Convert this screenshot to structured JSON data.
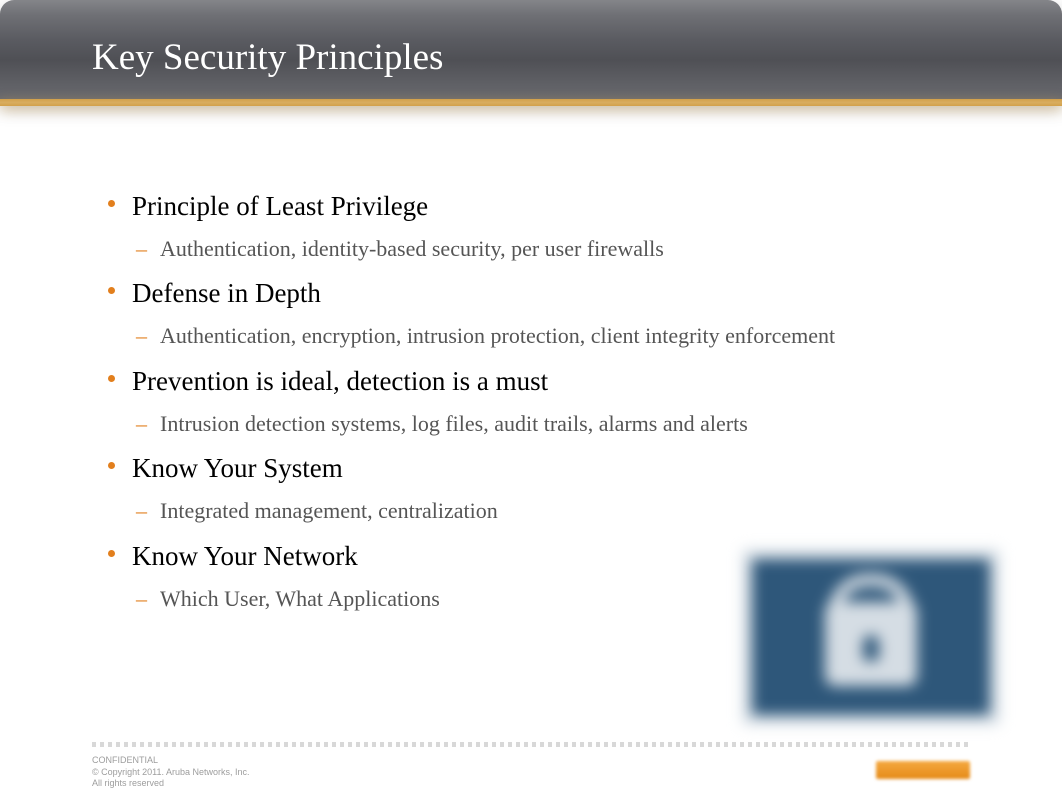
{
  "slide": {
    "title": "Key Security Principles",
    "items": [
      {
        "title": "Principle of Least Privilege",
        "sub": "Authentication, identity-based security, per user firewalls"
      },
      {
        "title": "Defense in Depth",
        "sub": "Authentication, encryption, intrusion protection, client integrity enforcement"
      },
      {
        "title": "Prevention is ideal, detection is a must",
        "sub": "Intrusion detection systems, log files, audit trails, alarms and alerts"
      },
      {
        "title": "Know Your System",
        "sub": "Integrated management, centralization"
      },
      {
        "title": "Know Your Network",
        "sub": "Which User, What Applications"
      }
    ]
  },
  "footer": {
    "line1": "CONFIDENTIAL",
    "line2": "© Copyright 2011. Aruba Networks, Inc.",
    "line3": "All rights reserved"
  }
}
